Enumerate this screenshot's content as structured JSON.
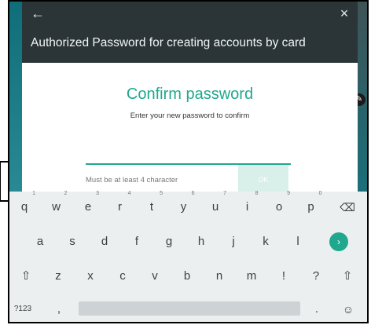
{
  "dialog": {
    "title": "Authorized Password for creating accounts by card",
    "back_icon": "back-arrow-icon",
    "close_icon": "close-icon",
    "close_glyph": "×",
    "back_glyph": "←"
  },
  "confirm": {
    "heading": "Confirm password",
    "subtitle": "Enter your new password to confirm",
    "password_value": "",
    "hint": "Must be at least 4 character",
    "ok_label": "OK"
  },
  "keyboard": {
    "row1": [
      {
        "key": "q",
        "num": "1"
      },
      {
        "key": "w",
        "num": "2"
      },
      {
        "key": "e",
        "num": "3"
      },
      {
        "key": "r",
        "num": "4"
      },
      {
        "key": "t",
        "num": "5"
      },
      {
        "key": "y",
        "num": "6"
      },
      {
        "key": "u",
        "num": "7"
      },
      {
        "key": "i",
        "num": "8"
      },
      {
        "key": "o",
        "num": "9"
      },
      {
        "key": "p",
        "num": "0"
      }
    ],
    "row2": [
      "a",
      "s",
      "d",
      "f",
      "g",
      "h",
      "j",
      "k",
      "l"
    ],
    "row3": [
      "z",
      "x",
      "c",
      "v",
      "b",
      "n",
      "m",
      "!",
      "?"
    ],
    "symbols_label": "?123",
    "comma": ",",
    "period": ".",
    "backspace_glyph": "⌫",
    "shift_glyph": "⇧",
    "enter_glyph": "›",
    "emoji_glyph": "☺"
  },
  "side": {
    "badge_glyph": "✎"
  },
  "colors": {
    "accent": "#1fa88d",
    "header": "#2b3537",
    "keyboard_bg": "#eceff0"
  }
}
